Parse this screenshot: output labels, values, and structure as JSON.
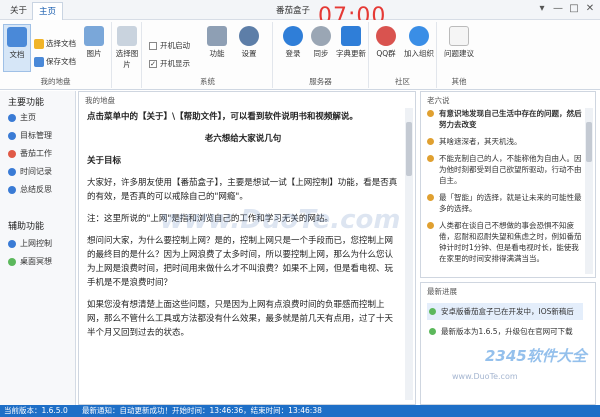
{
  "window": {
    "title": "番茄盒子",
    "clock": "07:00",
    "tabs": [
      "关于",
      "主页"
    ],
    "controls": [
      "▾",
      "—",
      "□",
      "✕"
    ]
  },
  "ribbon": {
    "groups": {
      "my_folder": "我的地盘",
      "system": "系统",
      "server": "服务器",
      "community": "社区",
      "other": "其他"
    },
    "doc_btn": "文档",
    "select_doc": "选择文档",
    "save_doc": "保存文档",
    "image": "图片",
    "select_image": "选择图片",
    "startup": "开机启动",
    "show_on_start": "开机显示",
    "function": "功能",
    "settings": "设置",
    "login": "登录",
    "sync": "同步",
    "dictionary": "字典更新",
    "qq": "QQ群",
    "join_group": "加入组织",
    "feedback": "问题建议"
  },
  "sidebar": {
    "main_title": "主要功能",
    "items": [
      "主页",
      "目标管理",
      "番茄工作",
      "时间记录",
      "总结反思"
    ],
    "aux_title": "辅助功能",
    "aux_items": [
      "上网控制",
      "桌面冥想"
    ]
  },
  "main": {
    "header": "我的地盘",
    "paragraphs": [
      "点击菜单中的【关于】\\【帮助文件】，可以看到软件说明书和视频解说。",
      "老六想给大家说几句",
      "关于目标",
      "大家好，许多朋友使用【番茄盒子】，主要是想试一试【上网控制】功能，看是否真的有效，是否真的可以戒除自己的\"网瘾\"。",
      "注：这里所说的\"上网\"是指和浏览自己的工作和学习无关的网站。",
      "想问问大家，为什么要控制上网？是的，控制上网只是一个手段而已，您控制上网的最终目的是什么？因为上网浪费了太多时间，所以要控制上网，那么为什么您认为上网是浪费时间，把时间用来做什么才不叫浪费？如果不上网，但是看电视、玩手机是不是浪费时间？",
      "如果您没有想清楚上面这些问题，只是因为上网有点浪费时间的负罪感而控制上网，那么不管什么工具或方法都没有什么效果，最多就是前几天有点用，过了十天半个月又回到过去的状态。"
    ]
  },
  "quotes": {
    "header": "老六说",
    "items": [
      "有意识地发现自己生活中存在的问题，然后努力去改变",
      "其啥遮深者，其天机浅。",
      "不能克制自己的人，不能称他为自由人。因为他时刻都受到自己欲望所驱动，行动不由自主。",
      "最「智能」的选择，就是让未来的可能性最多的选择。",
      "人类都在谈自己不想做的事会恐惧不知疲倦，忍耐和忍耐失望和焦虑之时，例如番茄钟计时时1分钟、但是看电视时长，能使我在家里的时间安排得满满当当。"
    ]
  },
  "news": {
    "header": "最新进展",
    "items": [
      "安卓版番茄盒子已在开发中，IOS新稿后",
      "最新版本为1.6.5，升级包在官网可下载"
    ]
  },
  "status": {
    "version": "当前版本：1.6.5.0",
    "notice": "最新通知：自动更新成功！开始时间：13:46:36，结束时间：13:46:38"
  },
  "watermarks": {
    "duote": "www.DuoTe.com",
    "logo": "2345软件大全",
    "site": "www.DuoTe.com"
  }
}
